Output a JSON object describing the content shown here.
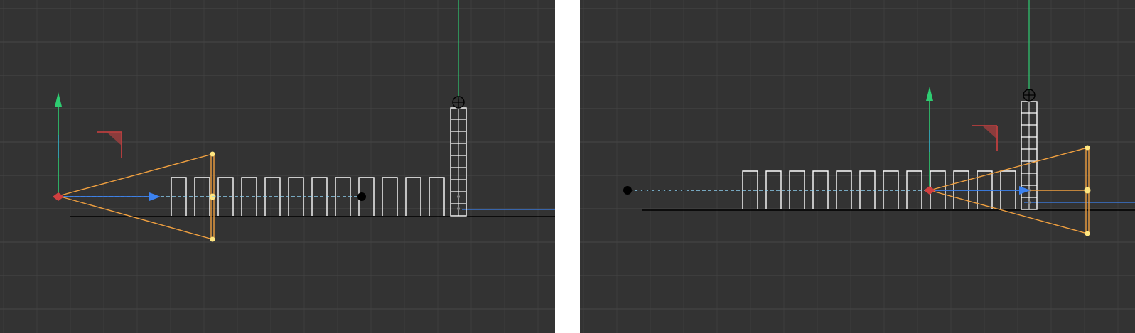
{
  "colors": {
    "viewport_background": "#333333",
    "grid_minor": "#3c3c3c",
    "grid_major": "#474747",
    "axis_y": "#2ecc71",
    "axis_z": "#3c82f0",
    "axis_x": "#d04040",
    "camera_frustum": "#f0a040",
    "camera_handle": "#ffe680",
    "light_blue_dashed": "#8ecff0",
    "geometry_wireframe": "#ffffff",
    "ground_line": "#000000",
    "target_point": "#000000"
  },
  "viewports": [
    {
      "id": "left",
      "icons": [
        "camera-gizmo-icon",
        "corner-marker-icon",
        "target-null-icon",
        "pivot-crosshair-icon"
      ]
    },
    {
      "id": "right",
      "icons": [
        "camera-gizmo-icon",
        "corner-marker-icon",
        "target-null-icon",
        "pivot-crosshair-icon"
      ]
    }
  ]
}
